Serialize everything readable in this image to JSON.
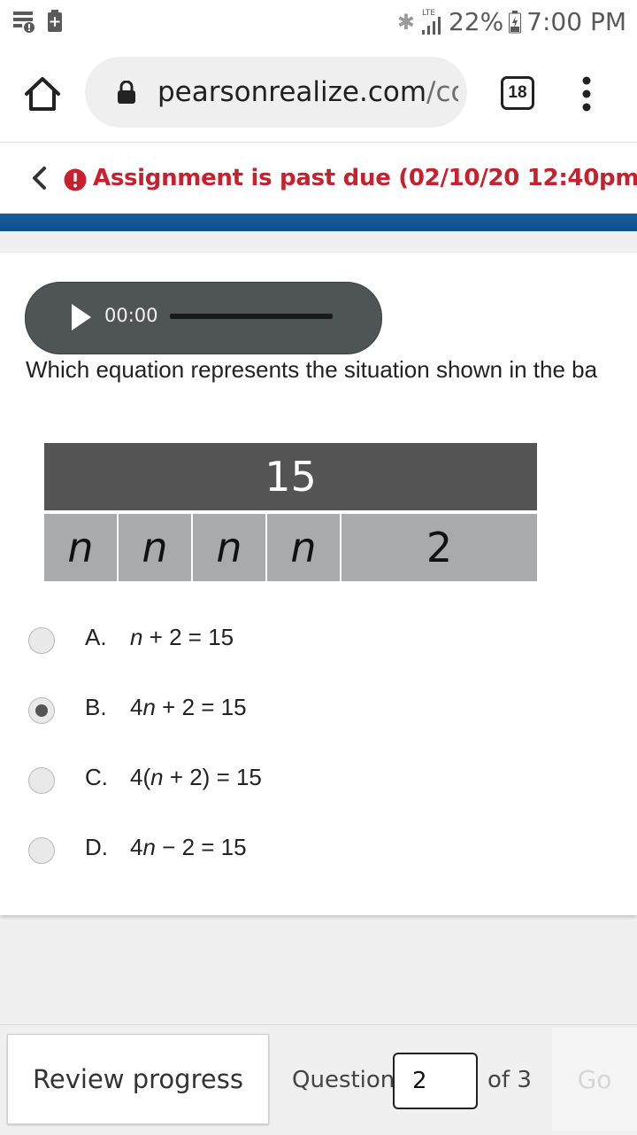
{
  "status_bar": {
    "network": "LTE",
    "battery": "22%",
    "time": "7:00 PM"
  },
  "browser": {
    "url_main": "pearsonrealize.com",
    "url_rest": "/co",
    "tab_count": "18"
  },
  "banner": {
    "due_message": "Assignment is past due (02/10/20 12:40pm)"
  },
  "audio": {
    "time": "00:00"
  },
  "question": {
    "prompt": "Which equation represents the situation shown in the ba",
    "bar_model": {
      "total": "15",
      "parts": [
        "n",
        "n",
        "n",
        "n",
        "2"
      ]
    },
    "options": [
      {
        "letter": "A.",
        "selected": false
      },
      {
        "letter": "B.",
        "selected": true
      },
      {
        "letter": "C.",
        "selected": false
      },
      {
        "letter": "D.",
        "selected": false
      }
    ],
    "option_text": {
      "a": {
        "v": "n",
        "rest": " + 2 = 15"
      },
      "b": {
        "pre": "4",
        "v": "n",
        "rest": " + 2 = 15"
      },
      "c": {
        "pre": "4(",
        "v": "n",
        "rest": " + 2) = 15"
      },
      "d": {
        "pre": "4",
        "v": "n",
        "rest": " − 2 = 15"
      }
    }
  },
  "footer": {
    "review_label": "Review progress",
    "question_label": "Question",
    "question_value": "2",
    "of_label": "of 3",
    "go_label": "Go"
  },
  "colors": {
    "due_red": "#c8202c",
    "accent_blue": "#1a5e9c",
    "bar_dark": "#545454",
    "bar_light": "#a9aaac"
  }
}
